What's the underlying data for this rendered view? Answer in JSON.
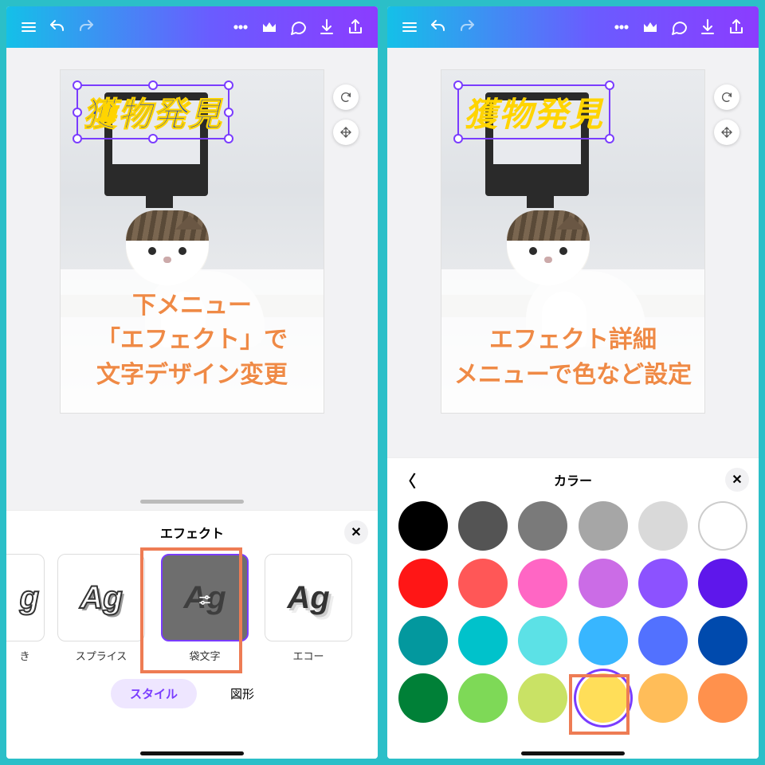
{
  "left": {
    "canvas_text": "獲物発見",
    "annotation": "下メニュー\n「エフェクト」で\n文字デザイン変更",
    "panel_title": "エフェクト",
    "effects": [
      {
        "sample": "g",
        "label": "き",
        "partial": true
      },
      {
        "sample": "Ag",
        "label": "スプライス"
      },
      {
        "sample": "Ag",
        "label": "袋文字",
        "selected": true
      },
      {
        "sample": "Ag",
        "label": "エコー"
      }
    ],
    "tabs": {
      "style": "スタイル",
      "shape": "図形"
    }
  },
  "right": {
    "canvas_text": "獲物発見",
    "annotation": "エフェクト詳細\nメニューで色など設定",
    "panel_title": "カラー",
    "colors": [
      "#000000",
      "#545454",
      "#7a7a7a",
      "#a6a6a6",
      "#d9d9d9",
      "#ffffff",
      "#ff1616",
      "#ff5757",
      "#ff66c4",
      "#cb6ce6",
      "#8c52ff",
      "#5e17eb",
      "#03989e",
      "#00c2cb",
      "#5ce1e6",
      "#38b6ff",
      "#5271ff",
      "#004aad",
      "#008037",
      "#7ed957",
      "#c9e265",
      "#ffde59",
      "#ffbd59",
      "#ff914d"
    ],
    "selected_color_index": 21
  }
}
